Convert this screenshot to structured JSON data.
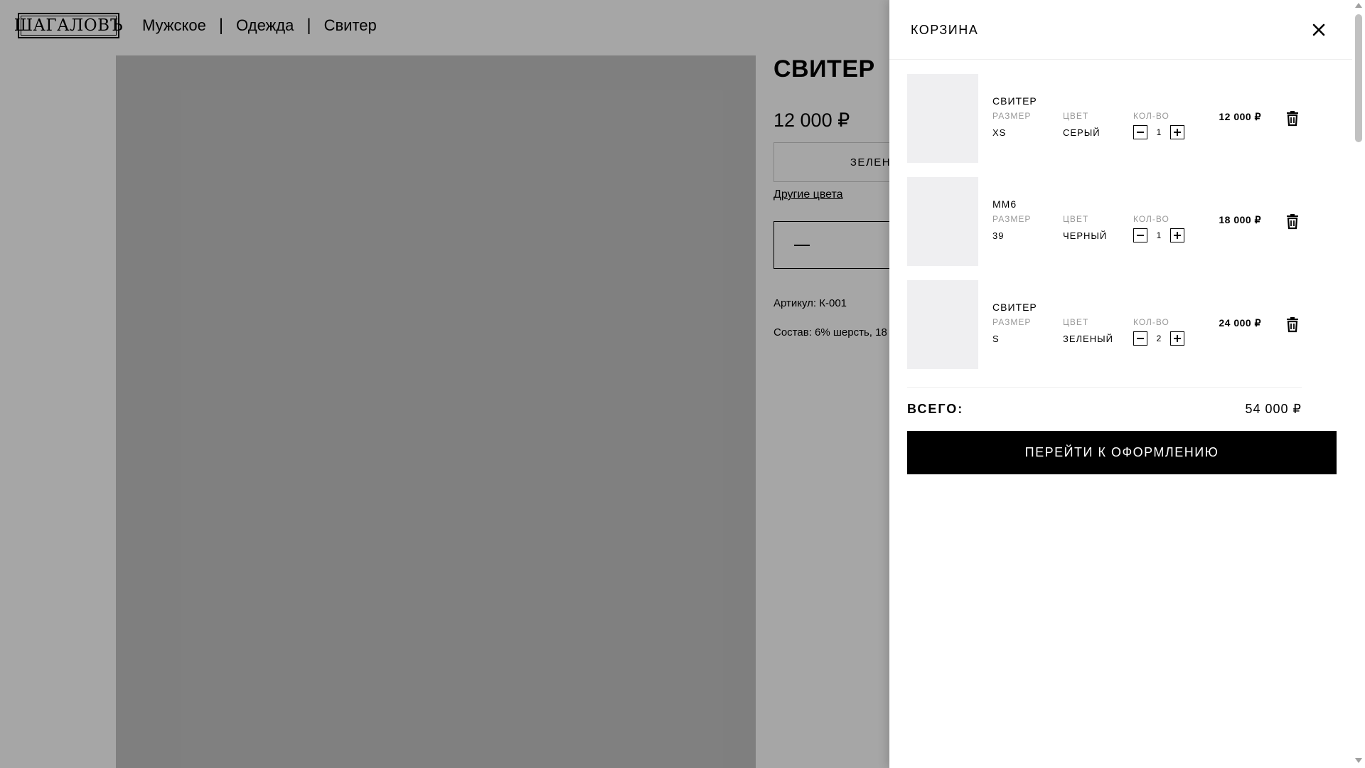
{
  "header": {
    "logo_text": "ШАГАЛОВЪ",
    "breadcrumb": [
      "Мужское",
      "Одежда",
      "Свитер"
    ],
    "separator": "|"
  },
  "product": {
    "title": "СВИТЕР",
    "price": "12 000 ₽",
    "color_partial": "ЗЕЛЕНЫЙ",
    "other_colors_link": "Другие цвета",
    "article": "Артикул: К-001",
    "composition": "Состав: 6% шерсть, 18"
  },
  "cart": {
    "title": "КОРЗИНА",
    "size_label": "РАЗМЕР",
    "color_label": "ЦВЕТ",
    "qty_label": "КОЛ-ВО",
    "items": [
      {
        "name": "СВИТЕР",
        "size": "XS",
        "color": "СЕРЫЙ",
        "qty": "1",
        "price": "12 000 ₽"
      },
      {
        "name": "ММ6",
        "size": "39",
        "color": "ЧЕРНЫЙ",
        "qty": "1",
        "price": "18 000 ₽"
      },
      {
        "name": "СВИТЕР",
        "size": "S",
        "color": "ЗЕЛЕНЫЙ",
        "qty": "2",
        "price": "24 000 ₽"
      }
    ],
    "total_label": "ВСЕГО:",
    "total_value": "54 000 ₽",
    "checkout_label": "ПЕРЕЙТИ К ОФОРМЛЕНИЮ"
  },
  "colors": {
    "overlay": "rgba(0,0,0,0.35)",
    "checkout_bg": "#000000",
    "thumb_bg": "#efeff1",
    "label_gray": "#999999"
  },
  "icons": [
    "close-icon",
    "trash-icon",
    "minus-icon",
    "plus-icon"
  ]
}
